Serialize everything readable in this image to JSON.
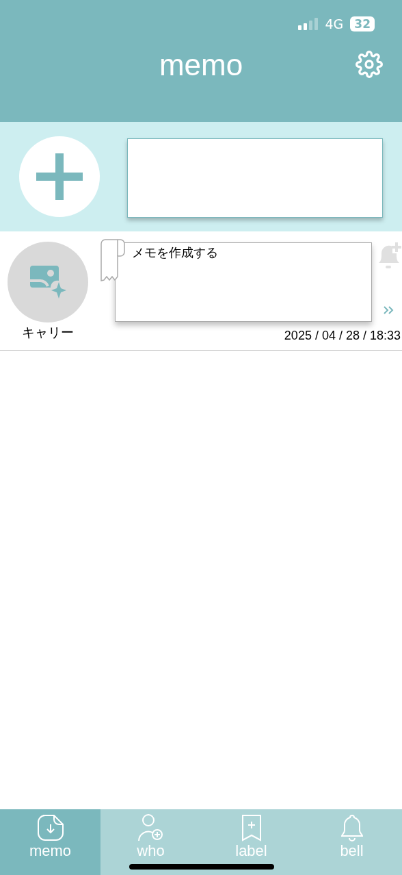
{
  "status_bar": {
    "network": "4G",
    "battery": "32"
  },
  "header": {
    "title": "memo"
  },
  "memos": [
    {
      "name": "キャリー",
      "text": "メモを作成する",
      "date": "2025 / 04 / 28 / 18:33"
    }
  ],
  "tabs": [
    {
      "label": "memo",
      "kind": "memo",
      "selected": true
    },
    {
      "label": "who",
      "kind": "who",
      "selected": false
    },
    {
      "label": "label",
      "kind": "label",
      "selected": false
    },
    {
      "label": "bell",
      "kind": "bell",
      "selected": false
    }
  ]
}
